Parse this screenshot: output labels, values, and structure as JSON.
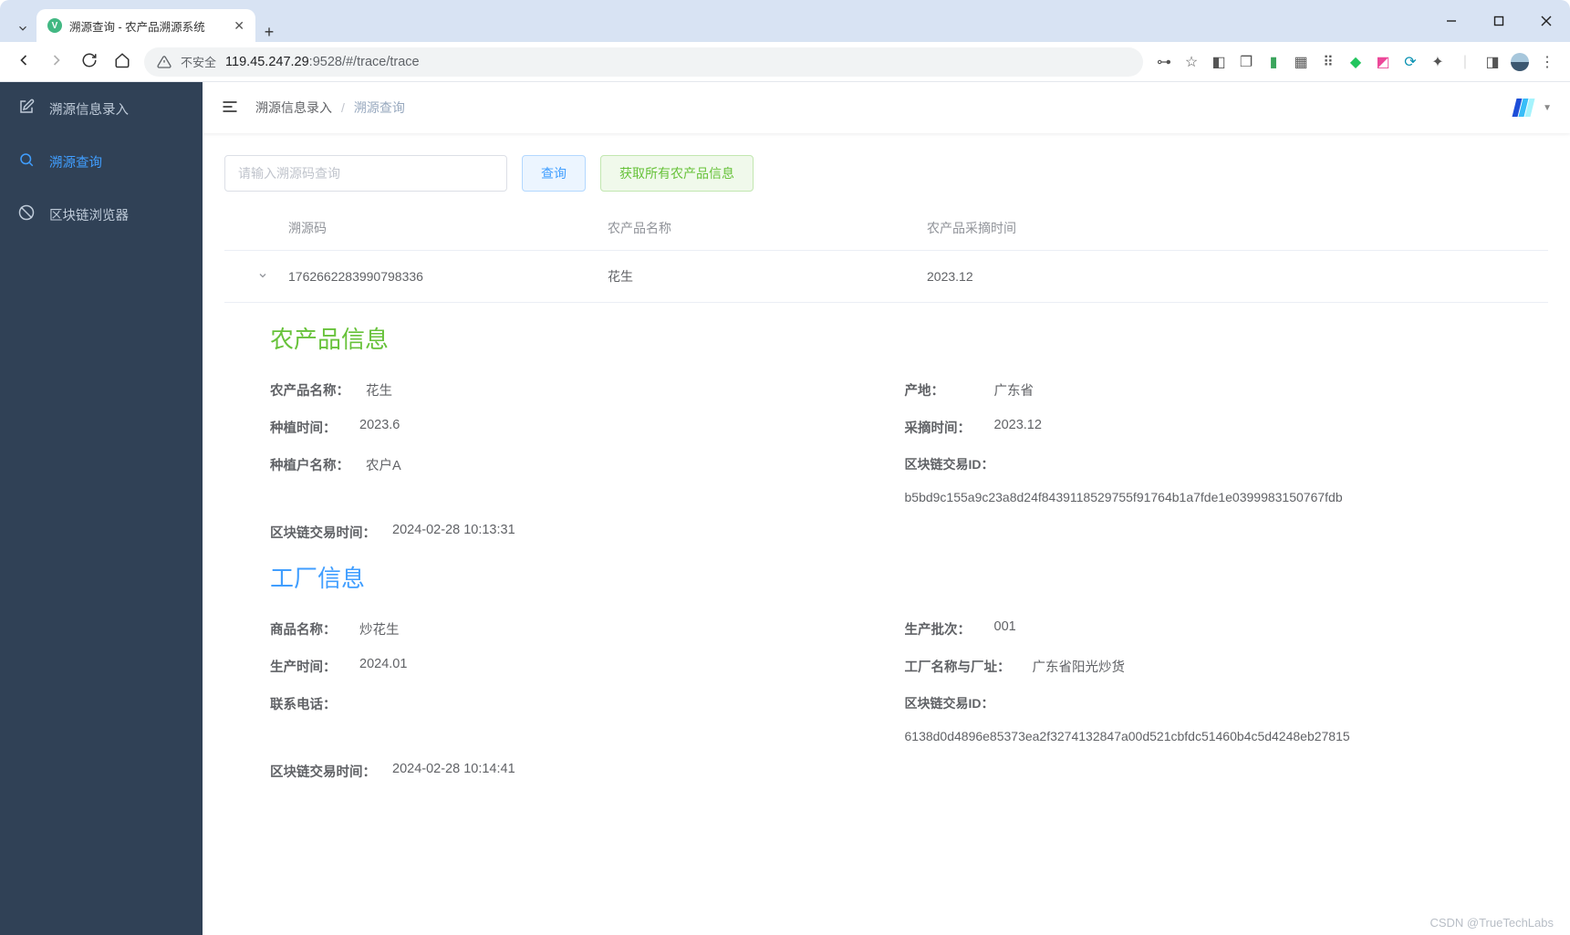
{
  "browser": {
    "tab_title": "溯源查询 - 农产品溯源系统",
    "url_warning": "不安全",
    "url_host": "119.45.247.29",
    "url_port": ":9528",
    "url_path": "/#/trace/trace"
  },
  "sidebar": {
    "items": [
      {
        "label": "溯源信息录入"
      },
      {
        "label": "溯源查询"
      },
      {
        "label": "区块链浏览器"
      }
    ]
  },
  "topbar": {
    "breadcrumb_parent": "溯源信息录入",
    "breadcrumb_current": "溯源查询"
  },
  "query": {
    "placeholder": "请输入溯源码查询",
    "search_label": "查询",
    "fetch_all_label": "获取所有农产品信息"
  },
  "table": {
    "headers": {
      "trace_code": "溯源码",
      "product_name": "农产品名称",
      "pick_time": "农产品采摘时间"
    },
    "row": {
      "trace_code": "1762662283990798336",
      "product_name": "花生",
      "pick_time": "2023.12"
    }
  },
  "detail": {
    "product_section_title": "农产品信息",
    "factory_section_title": "工厂信息",
    "labels": {
      "product_name": "农产品名称：",
      "origin": "产地：",
      "plant_time": "种植时间：",
      "harvest_time": "采摘时间：",
      "farmer_name": "种植户名称：",
      "tx_id": "区块链交易ID：",
      "tx_time": "区块链交易时间：",
      "goods_name": "商品名称：",
      "batch": "生产批次：",
      "produce_time": "生产时间：",
      "factory_name_addr": "工厂名称与厂址：",
      "contact_phone": "联系电话："
    },
    "product": {
      "name": "花生",
      "origin": "广东省",
      "plant_time": "2023.6",
      "harvest_time": "2023.12",
      "farmer_name": "农户A",
      "tx_id": "b5bd9c155a9c23a8d24f8439118529755f91764b1a7fde1e0399983150767fdb",
      "tx_time": "2024-02-28 10:13:31"
    },
    "factory": {
      "goods_name": "炒花生",
      "batch": "001",
      "produce_time": "2024.01",
      "name_addr": "广东省阳光炒货",
      "contact_phone": "",
      "tx_id": "6138d0d4896e85373ea2f3274132847a00d521cbfdc51460b4c5d4248eb27815",
      "tx_time": "2024-02-28 10:14:41"
    }
  },
  "watermark": "CSDN @TrueTechLabs"
}
